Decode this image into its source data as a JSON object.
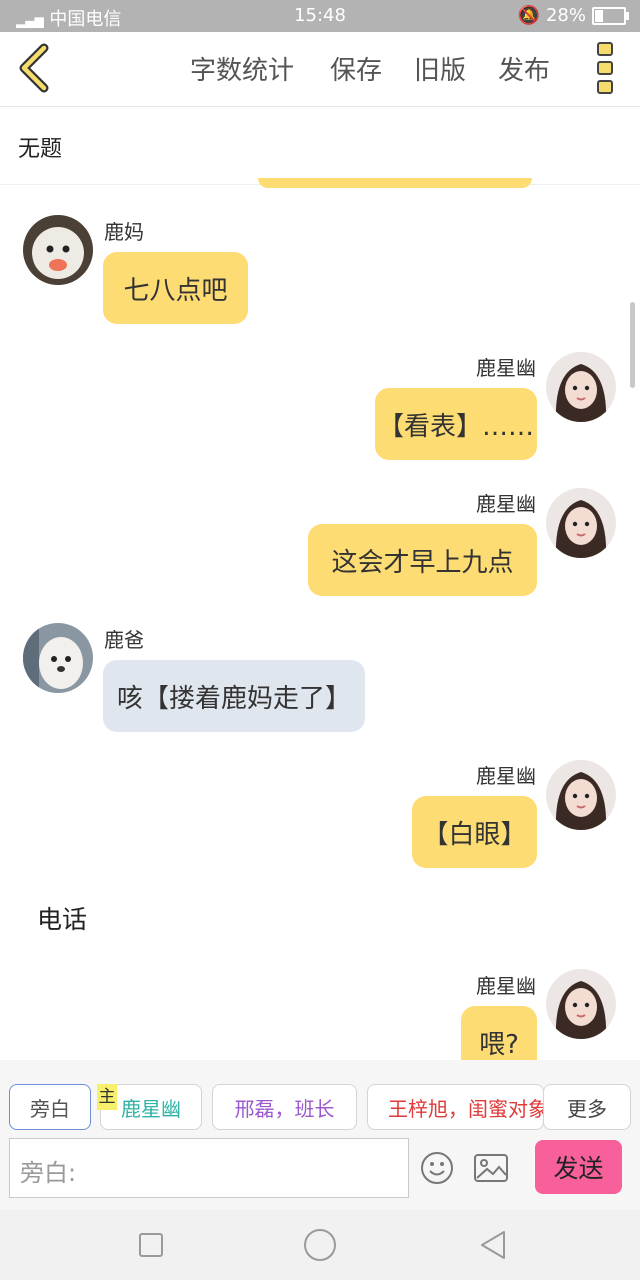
{
  "status_bar": {
    "carrier": "中国电信",
    "time": "15:48",
    "battery": "28%",
    "battery_level": 0.28
  },
  "toolbar": {
    "word_count": "字数统计",
    "save": "保存",
    "old_version": "旧版",
    "publish": "发布"
  },
  "title": "无题",
  "messages": [
    {
      "speaker": "鹿妈",
      "text": "七八点吧"
    },
    {
      "speaker": "鹿星幽",
      "text": "【看表】……"
    },
    {
      "speaker": "鹿星幽",
      "text": "这会才早上九点"
    },
    {
      "speaker": "鹿爸",
      "text": "咳【搂着鹿妈走了】"
    },
    {
      "speaker": "鹿星幽",
      "text": "【白眼】"
    },
    {
      "narration": "电话"
    },
    {
      "speaker": "鹿星幽",
      "text": "喂?"
    }
  ],
  "roles": {
    "narrator": "旁白",
    "host_badge": "主",
    "chips": [
      "鹿星幽",
      "邢磊，班长",
      "王梓旭，闺蜜对象"
    ],
    "more": "更多"
  },
  "input": {
    "placeholder": "旁白:"
  },
  "send_label": "发送",
  "colors": {
    "bubble_yellow": "#fddc73",
    "bubble_grey": "#e0e6ee",
    "send": "#f8609c",
    "chip_teal": "#2fb3a5",
    "chip_purple": "#9b59d0",
    "chip_red": "#e03a3a"
  },
  "icons": [
    "back-chevron-icon",
    "kebab-menu-icon",
    "emoji-icon",
    "image-icon",
    "nav-recent-icon",
    "nav-home-icon",
    "nav-back-icon"
  ]
}
